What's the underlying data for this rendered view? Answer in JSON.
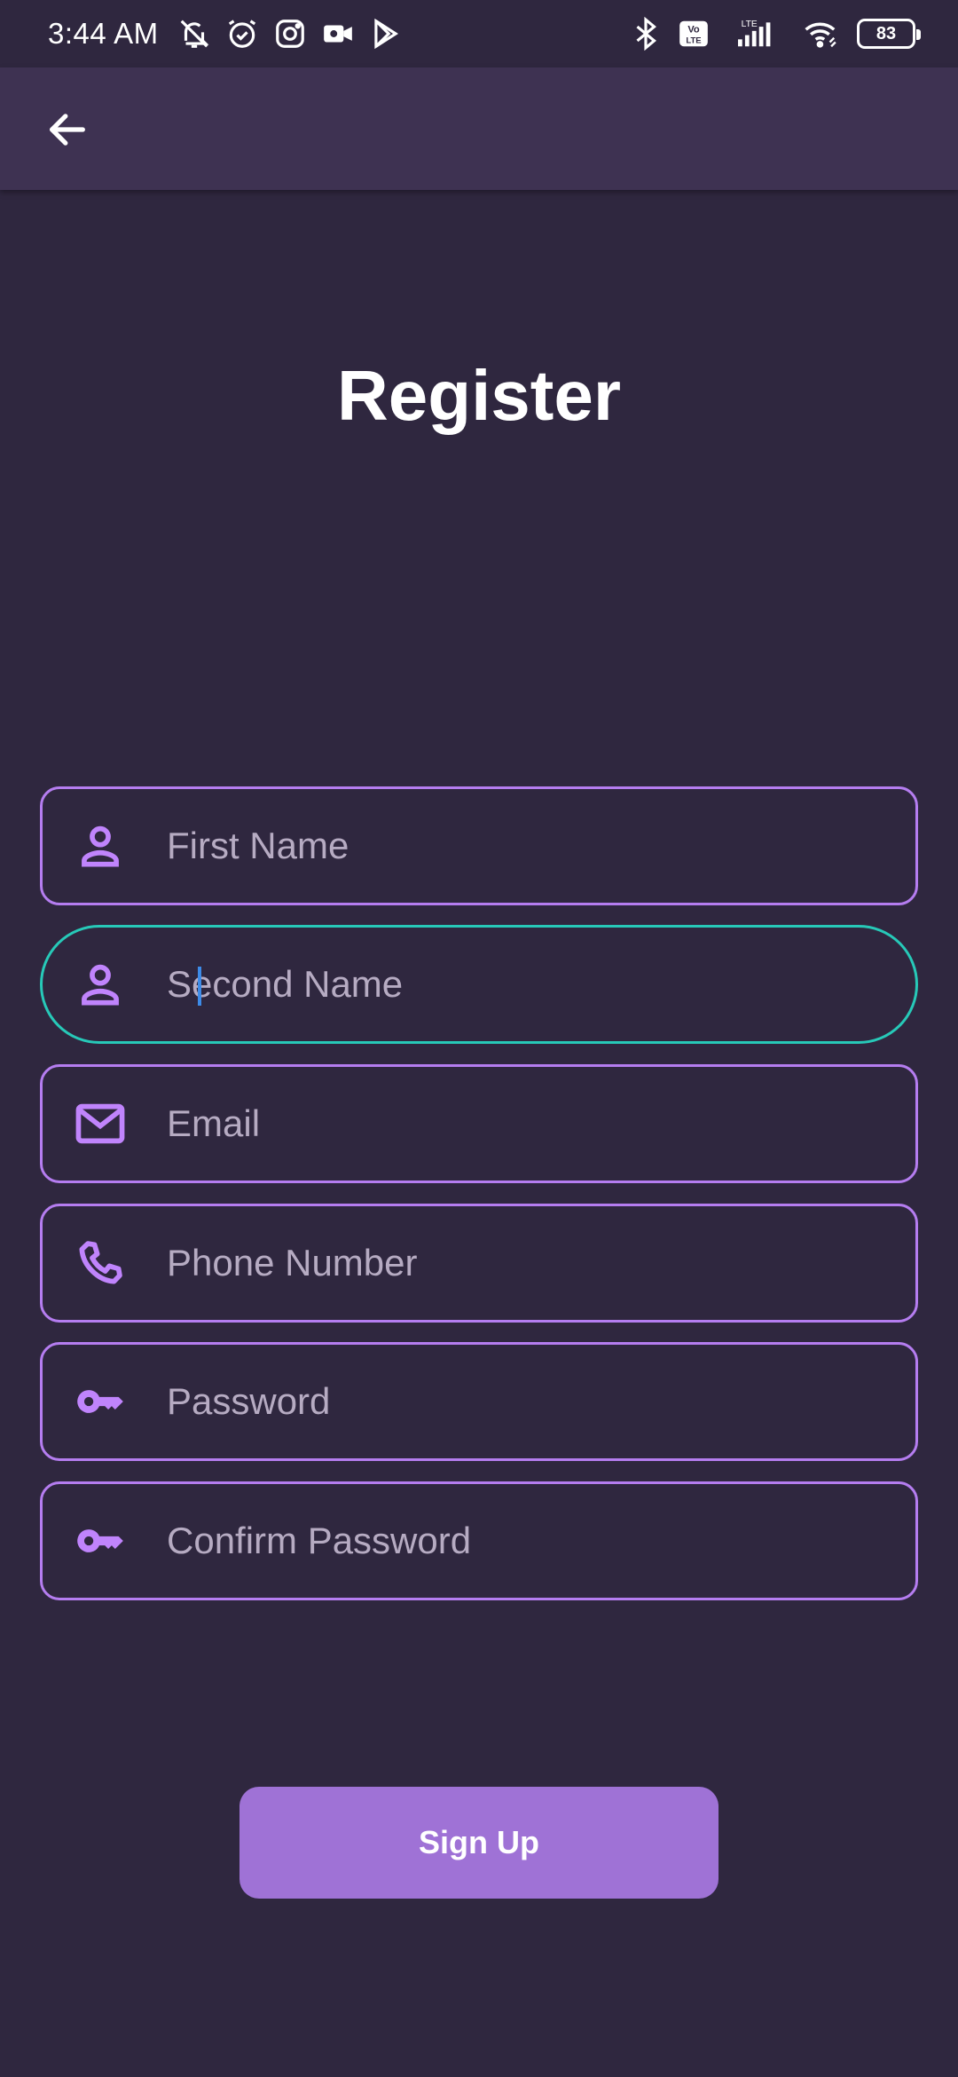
{
  "status_bar": {
    "time": "3:44 AM",
    "battery": "83",
    "left_icons": [
      "mute-icon",
      "alarm-icon",
      "instagram-icon",
      "video-camera-icon",
      "play-store-icon"
    ],
    "right_icons": [
      "bluetooth-icon",
      "volte-icon",
      "lte-signal-icon",
      "wifi-icon",
      "battery-icon"
    ]
  },
  "app_bar": {
    "back_icon": "arrow-left-icon"
  },
  "page": {
    "title": "Register"
  },
  "form": {
    "fields": [
      {
        "name": "first-name",
        "icon": "person-icon",
        "placeholder": "First Name",
        "value": ""
      },
      {
        "name": "second-name",
        "icon": "person-icon",
        "placeholder": "Second Name",
        "value": "",
        "focused": true
      },
      {
        "name": "email",
        "icon": "mail-icon",
        "placeholder": "Email",
        "value": ""
      },
      {
        "name": "phone",
        "icon": "phone-icon",
        "placeholder": "Phone Number",
        "value": ""
      },
      {
        "name": "password",
        "icon": "key-icon",
        "placeholder": "Password",
        "value": ""
      },
      {
        "name": "confirm-password",
        "icon": "key-icon",
        "placeholder": "Confirm Password",
        "value": ""
      }
    ],
    "submit_label": "Sign Up"
  },
  "colors": {
    "background": "#2f273f",
    "app_bar": "#3e3252",
    "field_border": "#b57df0",
    "focused_border": "#27c9b8",
    "icon": "#c084fc",
    "button": "#9f72d6",
    "placeholder": "#b6abc2"
  }
}
